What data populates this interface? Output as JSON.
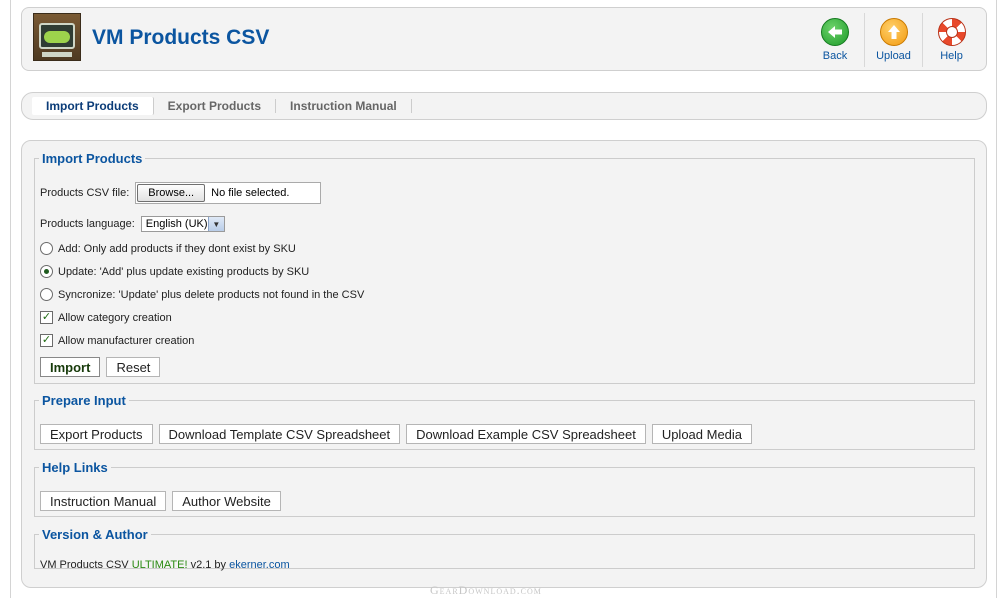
{
  "header": {
    "title": "VM Products CSV",
    "toolbar": [
      {
        "label": "Back",
        "icon": "back-arrow-icon"
      },
      {
        "label": "Upload",
        "icon": "upload-arrow-icon"
      },
      {
        "label": "Help",
        "icon": "lifebuoy-help-icon"
      }
    ]
  },
  "tabs": [
    {
      "label": "Import Products",
      "active": true
    },
    {
      "label": "Export Products",
      "active": false
    },
    {
      "label": "Instruction Manual",
      "active": false
    }
  ],
  "import": {
    "legend": "Import Products",
    "file_label": "Products CSV file:",
    "browse_label": "Browse...",
    "file_status": "No file selected.",
    "language_label": "Products language:",
    "language_value": "English (UK)",
    "modes": [
      {
        "label": "Add: Only add products if they dont exist by SKU",
        "selected": false
      },
      {
        "label": "Update: 'Add' plus update existing products by SKU",
        "selected": true
      },
      {
        "label": "Syncronize: 'Update' plus delete products not found in the CSV",
        "selected": false
      }
    ],
    "options": [
      {
        "label": "Allow category creation",
        "checked": true
      },
      {
        "label": "Allow manufacturer creation",
        "checked": true
      }
    ],
    "import_button": "Import",
    "reset_button": "Reset"
  },
  "prepare": {
    "legend": "Prepare Input",
    "buttons": [
      "Export Products",
      "Download Template CSV Spreadsheet",
      "Download Example CSV Spreadsheet",
      "Upload Media"
    ]
  },
  "help_links": {
    "legend": "Help Links",
    "buttons": [
      "Instruction Manual",
      "Author Website"
    ]
  },
  "version": {
    "legend": "Version & Author",
    "prefix": "VM Products CSV ",
    "edition": "ULTIMATE!",
    "suffix": " v2.1 by ",
    "author_link": "ekerner.com"
  },
  "watermark": "GearDownload.com",
  "colors": {
    "title": "#0b55a0",
    "panel": "#f3f3f3",
    "accent_green": "#2a8a12"
  }
}
